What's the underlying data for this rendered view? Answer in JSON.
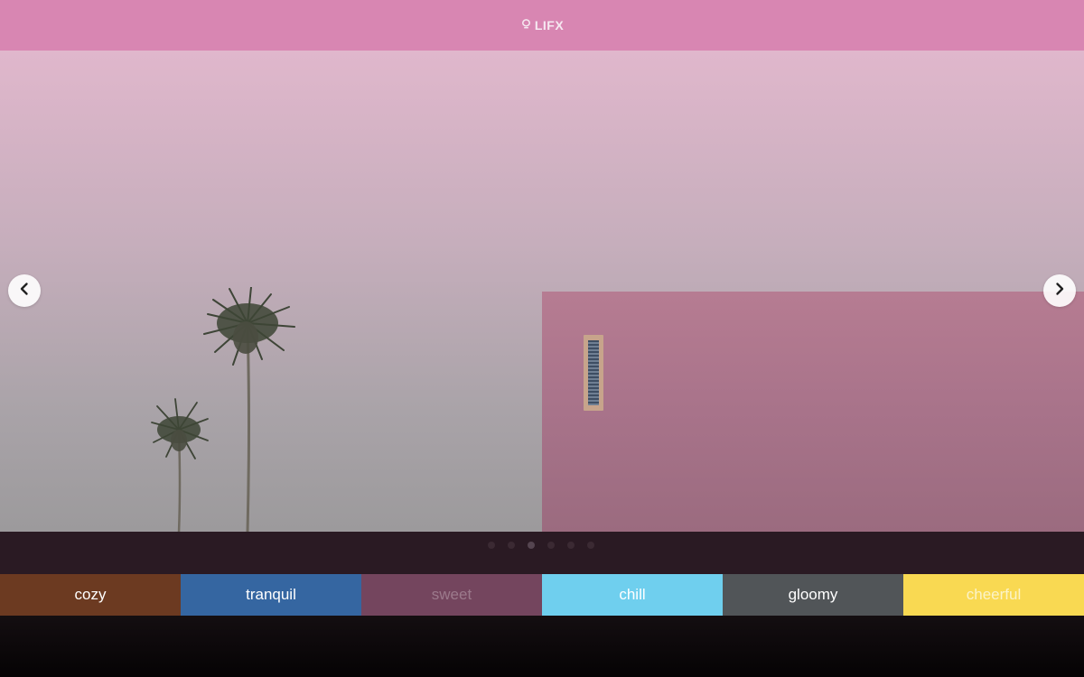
{
  "header": {
    "logo_text": "LIFX",
    "logo_icon": "bulb-icon",
    "background": "#d886b2"
  },
  "carousel": {
    "prev_icon": "chevron-left-icon",
    "next_icon": "chevron-right-icon",
    "slide_count": 6,
    "active_slide": 3
  },
  "moods": [
    {
      "label": "cozy",
      "color": "#6c3a21"
    },
    {
      "label": "tranquil",
      "color": "#3566a1"
    },
    {
      "label": "sweet",
      "color": "#74455e"
    },
    {
      "label": "chill",
      "color": "#6fcfee"
    },
    {
      "label": "gloomy",
      "color": "#515558"
    },
    {
      "label": "cheerful",
      "color": "#f9d952"
    }
  ]
}
